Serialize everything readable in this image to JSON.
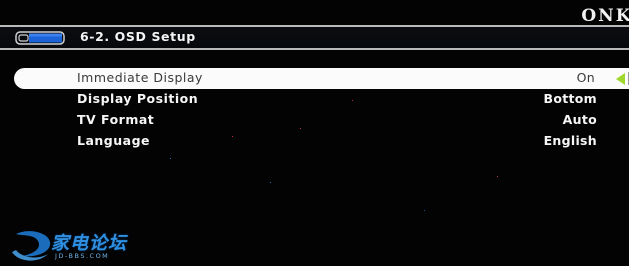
{
  "brand": {
    "logo_text": "ONKYO"
  },
  "header": {
    "title": "6-2.  OSD  Setup",
    "icon": "tv-monitor-icon"
  },
  "menu": {
    "items": [
      {
        "label": "Immediate Display",
        "value": "On",
        "selected": true
      },
      {
        "label": "Display Position",
        "value": "Bottom",
        "selected": false
      },
      {
        "label": "TV Format",
        "value": "Auto",
        "selected": false
      },
      {
        "label": "Language",
        "value": "English",
        "selected": false
      }
    ],
    "selected_arrow_icon": "left-arrow-icon"
  },
  "watermark": {
    "text": "家电论坛",
    "url": "JD-BBS.COM",
    "icon": "swirl-logo-icon"
  },
  "colors": {
    "background": "#030304",
    "header_border": "#b9b9b9",
    "selection_bar": "#fbfbfb",
    "arrow_accent": "#9fd82a",
    "text": "#f6f6f6",
    "selected_text": "#3a3a3a",
    "watermark": "#2f8fe0"
  }
}
